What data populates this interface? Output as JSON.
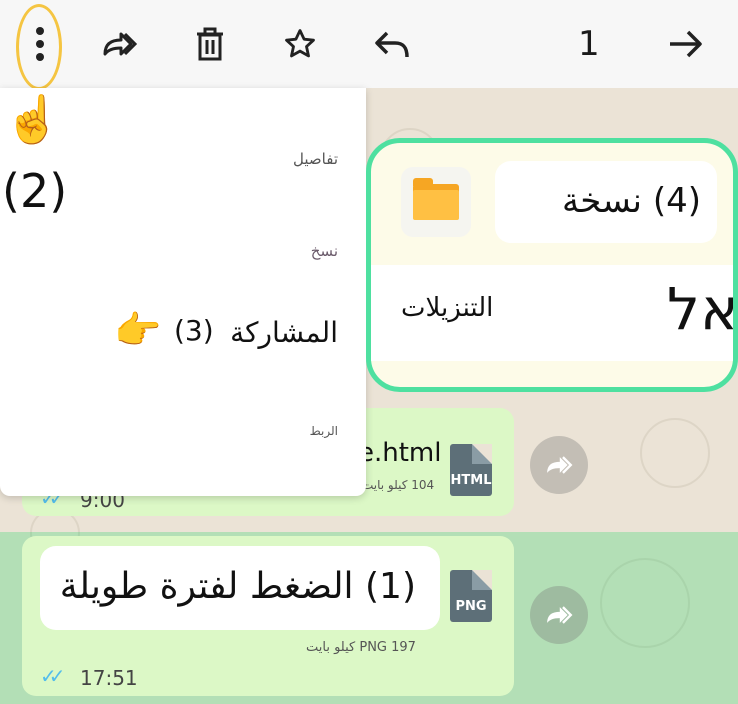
{
  "toolbar": {
    "selected_count": "1",
    "icons": [
      "more-vertical-icon",
      "forward-icon",
      "delete-icon",
      "star-icon",
      "reply-icon",
      "arrow-right-icon"
    ]
  },
  "menu": {
    "items": [
      {
        "label": "تفاصيل"
      },
      {
        "label": "نسخ"
      },
      {
        "label": "المشاركة"
      },
      {
        "label": "الربط"
      }
    ],
    "share_step": "(3)"
  },
  "steps": {
    "step2": "(2)",
    "step1": "(1) الضغط لفترة طويلة",
    "step4": "(4) نسخة"
  },
  "download_card": {
    "prefix": "אל",
    "label": "التنزيلات"
  },
  "messages": [
    {
      "filename": "e.html",
      "file_type": "HTML",
      "size": "104 كيلو بايت",
      "time": "9:00"
    },
    {
      "file_type": "PNG",
      "size": "197 PNG كيلو بايت",
      "time": "17:51"
    }
  ],
  "colors": {
    "oval_highlight": "#f5c542",
    "card_border": "#4ee0a0",
    "bubble": "#dcf8c6",
    "read_ticks": "#53bdeb"
  }
}
